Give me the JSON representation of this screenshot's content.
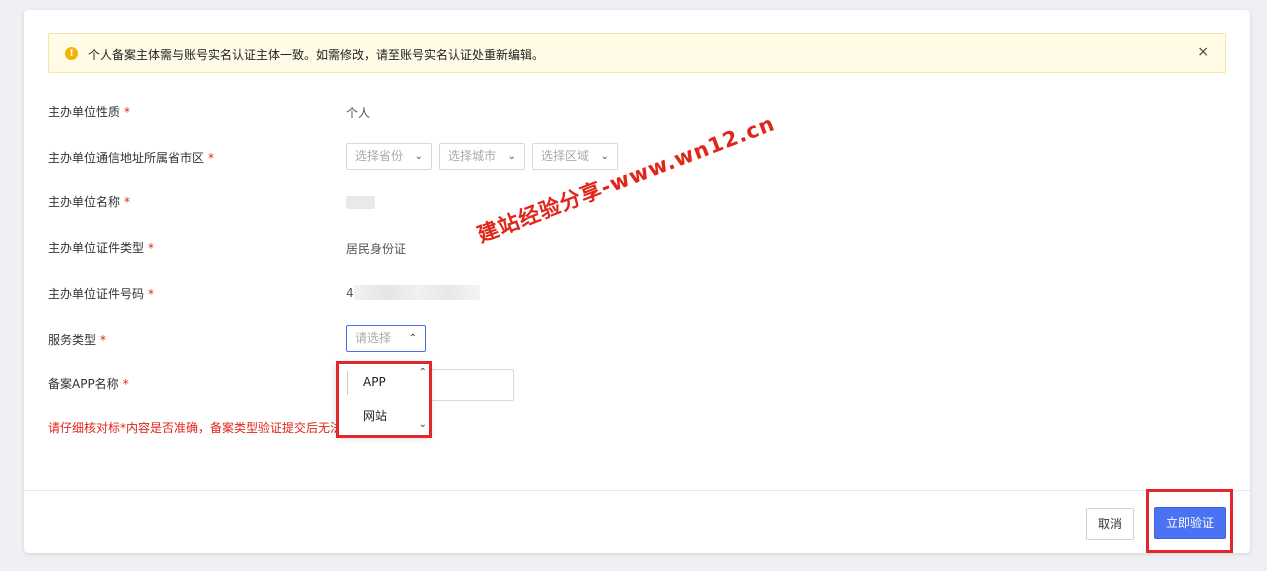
{
  "notice": {
    "message": "个人备案主体需与账号实名认证主体一致。如需修改，请至账号实名认证处重新编辑。",
    "close_icon": "×"
  },
  "form": {
    "required_mark": "*",
    "fields": {
      "nature": {
        "label": "主办单位性质",
        "value": "个人"
      },
      "region": {
        "label": "主办单位通信地址所属省市区",
        "province_placeholder": "选择省份",
        "city_placeholder": "选择城市",
        "district_placeholder": "选择区域"
      },
      "name": {
        "label": "主办单位名称"
      },
      "cert_type": {
        "label": "主办单位证件类型",
        "value": "居民身份证"
      },
      "cert_no": {
        "label": "主办单位证件号码",
        "value_prefix": "4"
      },
      "service_type": {
        "label": "服务类型",
        "placeholder": "请选择"
      },
      "app_name": {
        "label": "备案APP名称"
      }
    },
    "dropdown_options": [
      "APP",
      "网站"
    ],
    "warning": "请仔细核对标*内容是否准确，备案类型验证提交后无法修",
    "warning_tail": "!"
  },
  "footer": {
    "cancel_label": "取消",
    "submit_label": "立即验证"
  },
  "watermark": "建站经验分享-www.wn12.cn",
  "colors": {
    "accent": "#4a72f2",
    "required": "#e0251b",
    "highlight": "#e3262a",
    "notice_bg": "#fffbe6"
  }
}
